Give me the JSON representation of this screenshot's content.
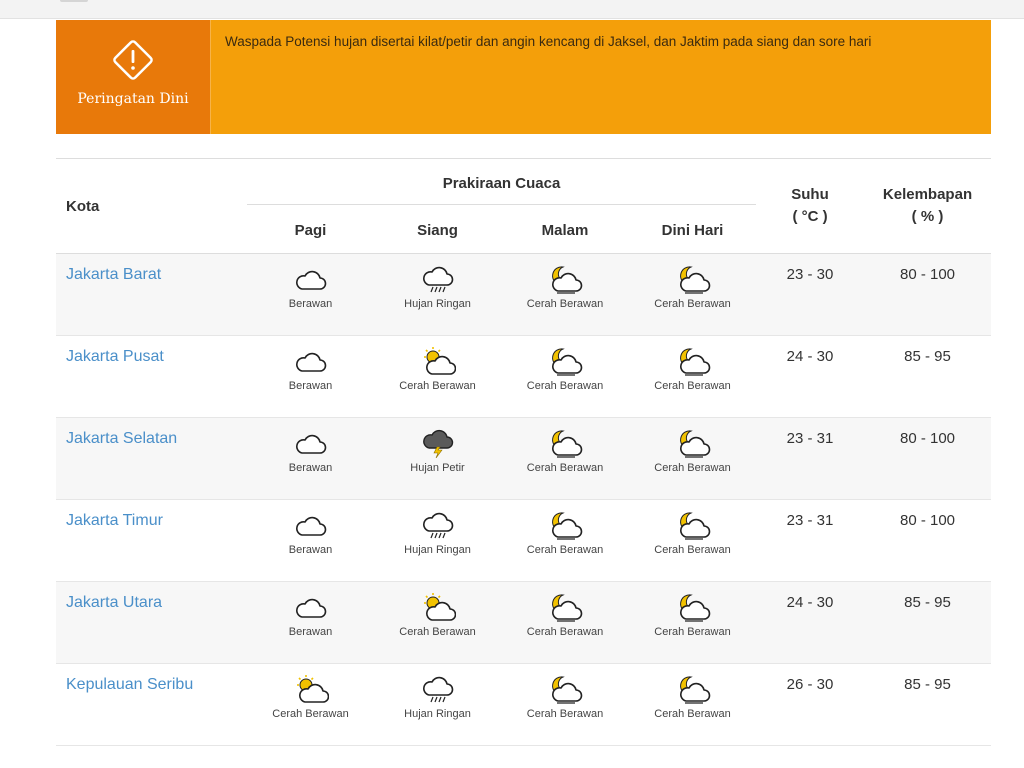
{
  "warning": {
    "label": "Peringatan Dini",
    "text": "Waspada Potensi hujan disertai kilat/petir dan angin kencang di Jaksel, dan Jaktim pada siang dan sore hari",
    "colors": {
      "banner": "#f49f0a",
      "badge": "#e8790a"
    }
  },
  "table": {
    "headers": {
      "city": "Kota",
      "forecast_group": "Prakiraan Cuaca",
      "periods": [
        "Pagi",
        "Siang",
        "Malam",
        "Dini Hari"
      ],
      "temp": "Suhu",
      "temp_unit": "( °C )",
      "humidity": "Kelembapan",
      "humidity_unit": "( % )"
    },
    "rows": [
      {
        "city": "Jakarta Barat",
        "forecast": [
          {
            "icon": "cloudy-icon",
            "label": "Berawan"
          },
          {
            "icon": "light-rain-icon",
            "label": "Hujan Ringan"
          },
          {
            "icon": "partly-cloudy-night-icon",
            "label": "Cerah Berawan"
          },
          {
            "icon": "partly-cloudy-night-icon",
            "label": "Cerah Berawan"
          }
        ],
        "temp": "23 - 30",
        "humidity": "80 - 100"
      },
      {
        "city": "Jakarta Pusat",
        "forecast": [
          {
            "icon": "cloudy-icon",
            "label": "Berawan"
          },
          {
            "icon": "partly-cloudy-day-icon",
            "label": "Cerah Berawan"
          },
          {
            "icon": "partly-cloudy-night-icon",
            "label": "Cerah Berawan"
          },
          {
            "icon": "partly-cloudy-night-icon",
            "label": "Cerah Berawan"
          }
        ],
        "temp": "24 - 30",
        "humidity": "85 - 95"
      },
      {
        "city": "Jakarta Selatan",
        "forecast": [
          {
            "icon": "cloudy-icon",
            "label": "Berawan"
          },
          {
            "icon": "thunderstorm-icon",
            "label": "Hujan Petir"
          },
          {
            "icon": "partly-cloudy-night-icon",
            "label": "Cerah Berawan"
          },
          {
            "icon": "partly-cloudy-night-icon",
            "label": "Cerah Berawan"
          }
        ],
        "temp": "23 - 31",
        "humidity": "80 - 100"
      },
      {
        "city": "Jakarta Timur",
        "forecast": [
          {
            "icon": "cloudy-icon",
            "label": "Berawan"
          },
          {
            "icon": "light-rain-icon",
            "label": "Hujan Ringan"
          },
          {
            "icon": "partly-cloudy-night-icon",
            "label": "Cerah Berawan"
          },
          {
            "icon": "partly-cloudy-night-icon",
            "label": "Cerah Berawan"
          }
        ],
        "temp": "23 - 31",
        "humidity": "80 - 100"
      },
      {
        "city": "Jakarta Utara",
        "forecast": [
          {
            "icon": "cloudy-icon",
            "label": "Berawan"
          },
          {
            "icon": "partly-cloudy-day-icon",
            "label": "Cerah Berawan"
          },
          {
            "icon": "partly-cloudy-night-icon",
            "label": "Cerah Berawan"
          },
          {
            "icon": "partly-cloudy-night-icon",
            "label": "Cerah Berawan"
          }
        ],
        "temp": "24 - 30",
        "humidity": "85 - 95"
      },
      {
        "city": "Kepulauan Seribu",
        "forecast": [
          {
            "icon": "partly-cloudy-day-icon",
            "label": "Cerah Berawan"
          },
          {
            "icon": "light-rain-icon",
            "label": "Hujan Ringan"
          },
          {
            "icon": "partly-cloudy-night-icon",
            "label": "Cerah Berawan"
          },
          {
            "icon": "partly-cloudy-night-icon",
            "label": "Cerah Berawan"
          }
        ],
        "temp": "26 - 30",
        "humidity": "85 - 95"
      }
    ],
    "colors": {
      "city_link": "#4a8fc9",
      "row_alt": "#f7f7f7",
      "sun": "#f2c200",
      "storm_cloud": "#5a5a5a"
    }
  }
}
